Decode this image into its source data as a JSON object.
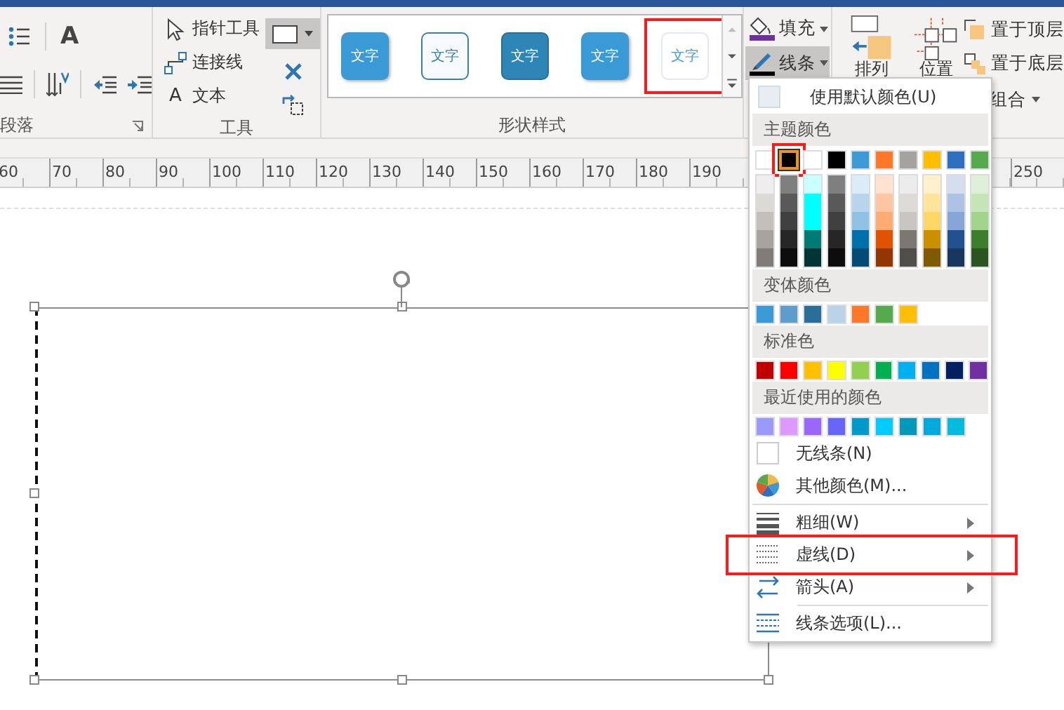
{
  "ribbon": {
    "paragraph": {
      "label": "段落",
      "font_icon": "A"
    },
    "tools": {
      "label": "工具",
      "items": [
        {
          "label": "指针工具",
          "kind": "pointer"
        },
        {
          "label": "连接线",
          "kind": "connector"
        },
        {
          "label": "文本",
          "kind": "text",
          "icon_char": "A"
        }
      ]
    },
    "shape_styles": {
      "label": "形状样式",
      "styles": [
        {
          "label": "文字",
          "kind": "filled",
          "highlighted": false
        },
        {
          "label": "文字",
          "kind": "outline",
          "highlighted": false
        },
        {
          "label": "文字",
          "kind": "dark",
          "highlighted": false
        },
        {
          "label": "文字",
          "kind": "filled",
          "highlighted": false
        },
        {
          "label": "文字",
          "kind": "subtle",
          "highlighted": true
        }
      ]
    },
    "format_buttons": [
      {
        "label": "填充",
        "kind": "fill",
        "selected": false
      },
      {
        "label": "线条",
        "kind": "line",
        "selected": true
      }
    ],
    "arrange": {
      "large_buttons": [
        {
          "label": "排列",
          "kind": "arrange"
        },
        {
          "label": "位置",
          "kind": "position"
        }
      ],
      "small_buttons": [
        {
          "label": "置于顶层",
          "kind": "front"
        },
        {
          "label": "置于底层",
          "kind": "back"
        }
      ],
      "group_button": {
        "label": "组合"
      }
    }
  },
  "ruler": {
    "labels": [
      "60",
      "70",
      "80",
      "90",
      "100",
      "110",
      "120",
      "130",
      "140",
      "150",
      "160",
      "170",
      "180",
      "190"
    ],
    "end_label": "250"
  },
  "canvas": {
    "shape": {
      "selected": true
    }
  },
  "line_menu": {
    "default_color": {
      "label": "使用默认颜色(U)"
    },
    "palettes": [
      {
        "title": "主题颜色",
        "kind": "theme",
        "colors": [
          {
            "color": "#ffffff",
            "selected": false,
            "highlighted": false,
            "shades": [
              {
                "color": "#eeeeee",
                "selected": false
              },
              {
                "color": "#dcdad6",
                "selected": false
              },
              {
                "color": "#c3c0bb",
                "selected": false
              },
              {
                "color": "#a7a4a0",
                "selected": false
              },
              {
                "color": "#7f7c79",
                "selected": false
              }
            ]
          },
          {
            "color": "#000000",
            "selected": true,
            "highlighted": true,
            "shades": [
              {
                "color": "#7f7f7f",
                "selected": false
              },
              {
                "color": "#595959",
                "selected": false
              },
              {
                "color": "#404040",
                "selected": false
              },
              {
                "color": "#262626",
                "selected": false
              },
              {
                "color": "#0d0d0d",
                "selected": false
              }
            ]
          },
          {
            "color": "#ffffff",
            "selected": false,
            "highlighted": false,
            "shades": [
              {
                "color": "#c9ffff",
                "selected": false
              },
              {
                "color": "#00ffff",
                "selected": false
              },
              {
                "color": "#00ffff",
                "selected": false
              },
              {
                "color": "#007b73",
                "selected": false
              },
              {
                "color": "#003535",
                "selected": false
              }
            ]
          },
          {
            "color": "#000000",
            "selected": false,
            "highlighted": false,
            "shades": [
              {
                "color": "#7f7f7f",
                "selected": false
              },
              {
                "color": "#595959",
                "selected": false
              },
              {
                "color": "#404040",
                "selected": false
              },
              {
                "color": "#262626",
                "selected": false
              },
              {
                "color": "#0d0d0d",
                "selected": false
              }
            ]
          },
          {
            "color": "#3a9ad6",
            "selected": false,
            "highlighted": false,
            "shades": [
              {
                "color": "#dbebf7",
                "selected": false
              },
              {
                "color": "#b7d6ee",
                "selected": false
              },
              {
                "color": "#8fc2e5",
                "selected": false
              },
              {
                "color": "#0070ad",
                "selected": false
              },
              {
                "color": "#004c76",
                "selected": false
              }
            ]
          },
          {
            "color": "#ff7828",
            "selected": false,
            "highlighted": false,
            "shades": [
              {
                "color": "#ffe3d0",
                "selected": false
              },
              {
                "color": "#ffc7a1",
                "selected": false
              },
              {
                "color": "#ffab72",
                "selected": false
              },
              {
                "color": "#e05300",
                "selected": false
              },
              {
                "color": "#923700",
                "selected": false
              }
            ]
          },
          {
            "color": "#a5a39f",
            "selected": false,
            "highlighted": false,
            "shades": [
              {
                "color": "#ececec",
                "selected": false
              },
              {
                "color": "#dcdbd8",
                "selected": false
              },
              {
                "color": "#c8c6c2",
                "selected": false
              },
              {
                "color": "#7b7874",
                "selected": false
              },
              {
                "color": "#504e4b",
                "selected": false
              }
            ]
          },
          {
            "color": "#ffbf00",
            "selected": false,
            "highlighted": false,
            "shades": [
              {
                "color": "#fff1cc",
                "selected": false
              },
              {
                "color": "#ffe49a",
                "selected": false
              },
              {
                "color": "#ffd767",
                "selected": false
              },
              {
                "color": "#cc8f00",
                "selected": false
              },
              {
                "color": "#7f5a00",
                "selected": false
              }
            ]
          },
          {
            "color": "#2e6fc0",
            "selected": false,
            "highlighted": false,
            "shades": [
              {
                "color": "#d5deef",
                "selected": false
              },
              {
                "color": "#adc3e4",
                "selected": false
              },
              {
                "color": "#86a6d8",
                "selected": false
              },
              {
                "color": "#21518e",
                "selected": false
              },
              {
                "color": "#18375f",
                "selected": false
              }
            ]
          },
          {
            "color": "#55ab4b",
            "selected": false,
            "highlighted": false,
            "shades": [
              {
                "color": "#def0d8",
                "selected": false
              },
              {
                "color": "#c5e5b7",
                "selected": false
              },
              {
                "color": "#a2d58c",
                "selected": false
              },
              {
                "color": "#3d7d2b",
                "selected": false
              },
              {
                "color": "#2a5420",
                "selected": false
              }
            ]
          }
        ]
      },
      {
        "title": "变体颜色",
        "kind": "flat",
        "colors": [
          {
            "color": "#3a9ad6",
            "selected": false
          },
          {
            "color": "#5e9ccb",
            "selected": false
          },
          {
            "color": "#2a6f9a",
            "selected": false
          },
          {
            "color": "#bcd2e8",
            "selected": false
          },
          {
            "color": "#ff7828",
            "selected": false
          },
          {
            "color": "#55ab4b",
            "selected": false
          },
          {
            "color": "#ffbf00",
            "selected": false
          }
        ]
      },
      {
        "title": "标准色",
        "kind": "flat",
        "colors": [
          {
            "color": "#c00000",
            "selected": false
          },
          {
            "color": "#ff0000",
            "selected": false
          },
          {
            "color": "#ffc000",
            "selected": false
          },
          {
            "color": "#ffff00",
            "selected": false
          },
          {
            "color": "#92d050",
            "selected": false
          },
          {
            "color": "#00b050",
            "selected": false
          },
          {
            "color": "#00b0f0",
            "selected": false
          },
          {
            "color": "#0070c0",
            "selected": false
          },
          {
            "color": "#002060",
            "selected": false
          },
          {
            "color": "#7030a0",
            "selected": false
          }
        ]
      },
      {
        "title": "最近使用的颜色",
        "kind": "flat",
        "colors": [
          {
            "color": "#9999ff",
            "selected": false
          },
          {
            "color": "#dd99ff",
            "selected": false
          },
          {
            "color": "#9966ff",
            "selected": false
          },
          {
            "color": "#6666ff",
            "selected": false
          },
          {
            "color": "#0099cc",
            "selected": false
          },
          {
            "color": "#00ccff",
            "selected": false
          },
          {
            "color": "#0099bb",
            "selected": false
          },
          {
            "color": "#00aadd",
            "selected": false
          },
          {
            "color": "#00bbdd",
            "selected": false
          }
        ]
      }
    ],
    "items": [
      {
        "label": "无线条(N)",
        "kind": "no-line",
        "submenu": false,
        "highlighted": false,
        "separator_before": false
      },
      {
        "label": "其他颜色(M)...",
        "kind": "more-colors",
        "submenu": false,
        "highlighted": false,
        "separator_before": false
      },
      {
        "label": "粗细(W)",
        "kind": "weight",
        "submenu": true,
        "highlighted": false,
        "separator_before": true,
        "separator_inset": false
      },
      {
        "label": "虚线(D)",
        "kind": "dash",
        "submenu": true,
        "highlighted": true,
        "separator_before": false
      },
      {
        "label": "箭头(A)",
        "kind": "arrow",
        "submenu": true,
        "highlighted": false,
        "separator_before": false
      },
      {
        "label": "线条选项(L)...",
        "kind": "options",
        "submenu": false,
        "highlighted": false,
        "separator_before": true,
        "separator_inset": true
      }
    ]
  }
}
